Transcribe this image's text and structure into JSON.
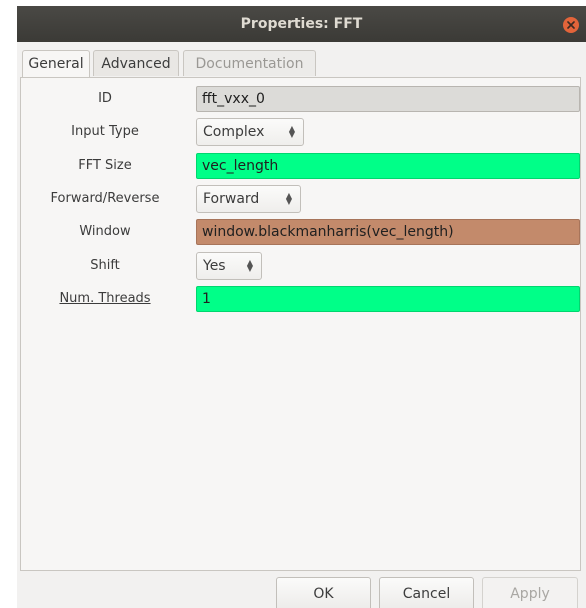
{
  "window": {
    "title": "Properties: FFT"
  },
  "tabs": [
    {
      "label": "General",
      "state": "active"
    },
    {
      "label": "Advanced",
      "state": "normal"
    },
    {
      "label": "Documentation",
      "state": "disabled"
    }
  ],
  "properties": {
    "id": {
      "label": "ID",
      "value": "fft_vxx_0"
    },
    "input_type": {
      "label": "Input Type",
      "value": "Complex"
    },
    "fft_size": {
      "label": "FFT Size",
      "value": "vec_length"
    },
    "forward_reverse": {
      "label": "Forward/Reverse",
      "value": "Forward"
    },
    "window": {
      "label": "Window",
      "value": "window.blackmanharris(vec_length)"
    },
    "shift": {
      "label": "Shift",
      "value": "Yes"
    },
    "num_threads": {
      "label": "Num. Threads",
      "value": "1"
    }
  },
  "buttons": {
    "ok": "OK",
    "cancel": "Cancel",
    "apply": "Apply"
  },
  "colors": {
    "titlebar": "#3b3a36",
    "close": "#e3643a",
    "valid_field": "#00ff88",
    "window_field": "#c38a6b",
    "readonly_field": "#dcdbd8"
  }
}
